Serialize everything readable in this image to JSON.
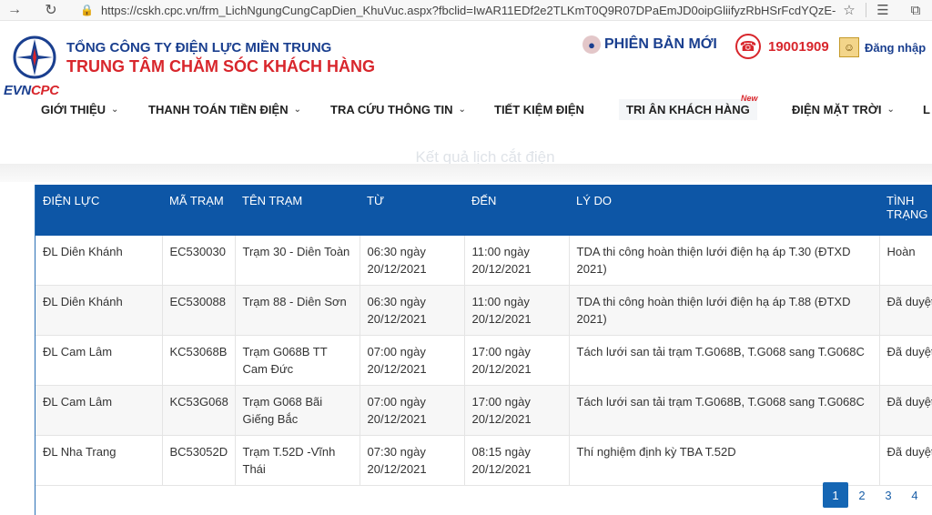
{
  "browser": {
    "url": "https://cskh.cpc.vn/frm_LichNgungCungCapDien_KhuVuc.aspx?fbclid=IwAR11EDf2e2TLKmT0Q9R07DPaEmJD0oipGliifyzRbHSrFcdYQzE-o..."
  },
  "header": {
    "brand_evn": "EVN",
    "brand_cpc": "CPC",
    "company_line1": "TỔNG CÔNG TY ĐIỆN LỰC MIỀN TRUNG",
    "company_line2": "TRUNG TÂM CHĂM SÓC KHÁCH HÀNG",
    "new_version": "PHIÊN BẢN MỚI",
    "hotline": "19001909",
    "login": "Đăng nhập"
  },
  "nav": {
    "items": [
      {
        "label": "GIỚI THIỆU",
        "has_menu": true
      },
      {
        "label": "THANH TOÁN TIỀN ĐIỆN",
        "has_menu": true
      },
      {
        "label": "TRA CỨU THÔNG TIN",
        "has_menu": true
      },
      {
        "label": "TIẾT KIỆM ĐIỆN",
        "has_menu": false
      },
      {
        "label": "TRI ÂN KHÁCH HÀNG",
        "has_menu": false
      },
      {
        "label": "ĐIỆN MẶT TRỜI",
        "has_menu": true
      },
      {
        "label": "L",
        "has_menu": false
      }
    ],
    "new_badge": "New"
  },
  "page": {
    "heading": "Kết quả lịch cắt điện"
  },
  "table": {
    "headers": [
      "ĐIỆN LỰC",
      "MÃ TRẠM",
      "TÊN TRẠM",
      "TỪ",
      "ĐẾN",
      "LÝ DO",
      "TÌNH TRẠNG"
    ],
    "rows": [
      [
        "ĐL Diên Khánh",
        "EC530030",
        "Trạm 30 - Diên Toàn",
        "06:30 ngày 20/12/2021",
        "11:00 ngày 20/12/2021",
        "TDA thi công hoàn thiện lưới điện hạ áp T.30 (ĐTXD 2021)",
        "Hoàn"
      ],
      [
        "ĐL Diên Khánh",
        "EC530088",
        "Trạm 88 - Diên Sơn",
        "06:30 ngày 20/12/2021",
        "11:00 ngày 20/12/2021",
        "TDA thi công hoàn thiện lưới điện hạ áp T.88 (ĐTXD 2021)",
        "Đã duyệt"
      ],
      [
        "ĐL Cam Lâm",
        "KC53068B",
        "Trạm G068B TT Cam Đức",
        "07:00 ngày 20/12/2021",
        "17:00 ngày 20/12/2021",
        "Tách lưới san tải trạm T.G068B, T.G068 sang T.G068C",
        "Đã duyệt"
      ],
      [
        "ĐL Cam Lâm",
        "KC53G068",
        "Trạm G068 Bãi Giếng Bắc",
        "07:00 ngày 20/12/2021",
        "17:00 ngày 20/12/2021",
        "Tách lưới san tải trạm T.G068B, T.G068 sang T.G068C",
        "Đã duyệt"
      ],
      [
        "ĐL Nha Trang",
        "BC53052D",
        "Trạm T.52D -Vĩnh Thái",
        "07:30 ngày 20/12/2021",
        "08:15 ngày 20/12/2021",
        "Thí nghiệm định kỳ TBA T.52D",
        "Đã duyệt"
      ]
    ]
  },
  "pagination": {
    "pages": [
      "1",
      "2",
      "3",
      "4"
    ],
    "active": "1"
  }
}
